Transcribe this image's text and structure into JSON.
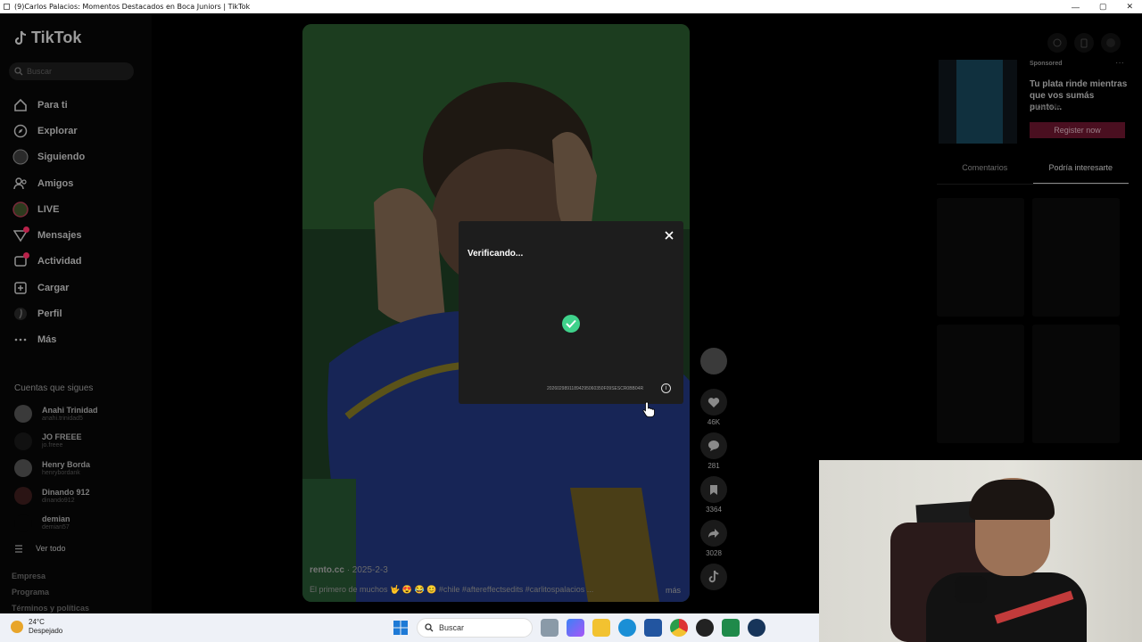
{
  "window": {
    "title": "(9)Carlos Palacios: Momentos Destacados en Boca Juniors | TikTok",
    "minimize": "—",
    "maximize": "▢",
    "close": "✕"
  },
  "brand": {
    "name": "TikTok"
  },
  "search": {
    "placeholder": "Buscar"
  },
  "nav": [
    {
      "label": "Para ti",
      "icon": "home-icon"
    },
    {
      "label": "Explorar",
      "icon": "compass-icon"
    },
    {
      "label": "Siguiendo",
      "icon": "following-icon"
    },
    {
      "label": "Amigos",
      "icon": "friends-icon"
    },
    {
      "label": "LIVE",
      "icon": "live-icon"
    },
    {
      "label": "Mensajes",
      "icon": "messages-icon"
    },
    {
      "label": "Actividad",
      "icon": "activity-icon"
    },
    {
      "label": "Cargar",
      "icon": "upload-icon"
    },
    {
      "label": "Perfil",
      "icon": "profile-icon"
    },
    {
      "label": "Más",
      "icon": "more-icon"
    }
  ],
  "following": {
    "title": "Cuentas que sigues",
    "accounts": [
      {
        "name": "Anahi Trinidad",
        "handle": "anahi.trinidad5"
      },
      {
        "name": "JO FREEE",
        "handle": "jo.freee"
      },
      {
        "name": "Henry Borda",
        "handle": "henrybordank"
      },
      {
        "name": "Dinando 912",
        "handle": "dinando912"
      },
      {
        "name": "demian",
        "handle": "demian57"
      }
    ],
    "see_all": "Ver todo"
  },
  "footer": [
    "Empresa",
    "Programa",
    "Términos y políticas"
  ],
  "video": {
    "author": "rento.cc",
    "date": "· 2025-2-3",
    "caption": "El primero de muchos 🤟 😍 😂 😊 #chile #aftereffectsedits #carlitospalacios ...",
    "more": "más"
  },
  "actions": {
    "likes": "46K",
    "comments": "281",
    "saves": "3364",
    "shares": "3028"
  },
  "ad": {
    "sponsored": "Sponsored",
    "text": "Tu plata rinde mientras que vos sumás punto...",
    "brand": "Supervielle",
    "cta": "Register now"
  },
  "right_tabs": {
    "comments": "Comentarios",
    "suggested": "Podría interesarte"
  },
  "verify": {
    "title": "Verificando...",
    "code": "20260298911894295060350F09SESCR0BB04R"
  },
  "taskbar": {
    "temp": "24°C",
    "condition": "Despejado",
    "search": "Buscar"
  }
}
